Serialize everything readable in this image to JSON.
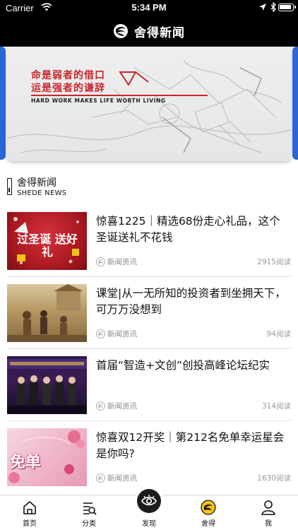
{
  "status_bar": {
    "carrier": "Carrier",
    "time": "5:34 PM"
  },
  "nav": {
    "title": "舍得新闻",
    "logo_icon": "shede-logo-icon"
  },
  "banner": {
    "line1": "命是弱者的借口",
    "line2": "运是强者的谦辞",
    "subline": "HARD WORK MAKES LIFE WORTH LIVING",
    "accent_color": "#c8262b"
  },
  "section": {
    "title": "舍得新闻",
    "subtitle": "SHEDE NEWS"
  },
  "news": [
    {
      "headline": "惊喜1225｜精选68份走心礼品，这个圣诞送礼不花钱",
      "source": "新闻资讯",
      "reads": "2915阅读",
      "thumb_text": "过圣诞 送好礼"
    },
    {
      "headline": "课堂|从一无所知的投资者到坐拥天下，可万万没想到",
      "source": "新闻资讯",
      "reads": "94阅读"
    },
    {
      "headline": "首届“智造+文创”创投高峰论坛纪实",
      "source": "新闻资讯",
      "reads": "314阅读"
    },
    {
      "headline": "惊喜双12开奖｜第212名免单幸运星会是你吗?",
      "source": "新闻资讯",
      "reads": "1630阅读",
      "thumb_text": "免单"
    }
  ],
  "tabs": [
    {
      "label": "首页",
      "icon": "home-icon"
    },
    {
      "label": "分类",
      "icon": "category-list-icon"
    },
    {
      "label": "发现",
      "icon": "eye-discover-icon"
    },
    {
      "label": "舍得",
      "icon": "shede-tab-icon"
    },
    {
      "label": "我",
      "icon": "user-profile-icon"
    }
  ],
  "colors": {
    "bar_bg": "#000000",
    "tab_active_yellow": "#f2c21a",
    "banner_side": "#2a66d8"
  }
}
